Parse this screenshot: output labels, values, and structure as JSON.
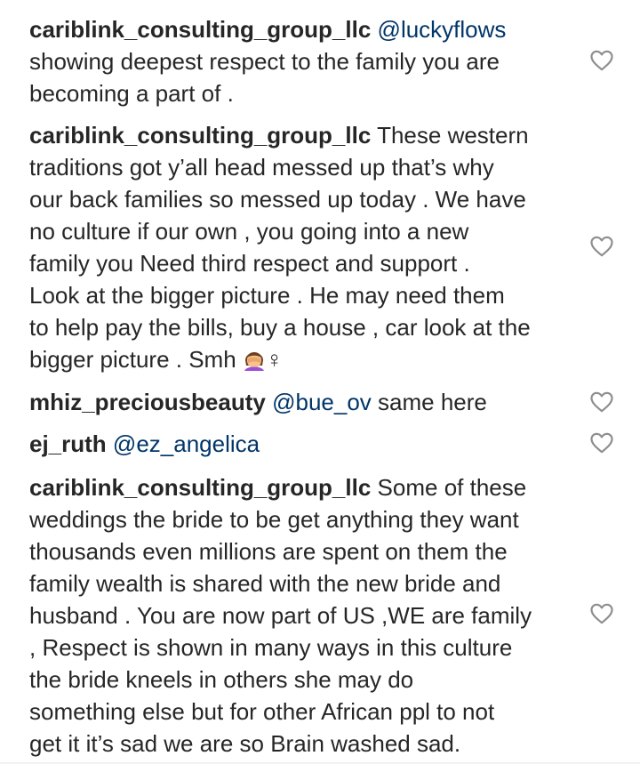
{
  "comments": [
    {
      "username": "cariblink_consulting_group_llc",
      "mention": "@luckyflows",
      "lines": [
        "showing deepest respect to the family you are",
        "becoming a part of ."
      ],
      "like_icon": "heart-outline-icon"
    },
    {
      "username": "cariblink_consulting_group_llc",
      "first_line": "These western",
      "lines": [
        "traditions got y’all head messed up that’s why",
        "our back families so messed up today . We have",
        "no culture if our own , you going into a new",
        "family you Need third respect and support .",
        "Look at the bigger picture . He may need them",
        "to help pay the bills, buy a house , car look at the"
      ],
      "last_line": "bigger picture . Smh",
      "last_line_emoji": "woman-facepalming-emoji",
      "like_icon": "heart-outline-icon"
    },
    {
      "username": "mhiz_preciousbeauty",
      "mention": "@bue_ov",
      "text": "same here",
      "like_icon": "heart-outline-icon"
    },
    {
      "username": "ej_ruth",
      "mention": "@ez_angelica",
      "like_icon": "heart-outline-icon"
    },
    {
      "username": "cariblink_consulting_group_llc",
      "first_line": "Some of these",
      "lines": [
        "weddings the bride to be get anything they want",
        "thousands even millions are spent on them the",
        "family wealth is shared with the new bride and",
        "husband . You are now part of US ,WE are family",
        ", Respect is shown in many ways in this culture",
        "the bride kneels in others she may do",
        "something else but for other African ppl to not",
        "get it it’s sad we are so Brain washed sad."
      ],
      "like_icon": "heart-outline-icon"
    }
  ],
  "colors": {
    "text": "#262626",
    "mention": "#003569",
    "heart_stroke": "#8e8e8e",
    "background": "#ffffff"
  }
}
